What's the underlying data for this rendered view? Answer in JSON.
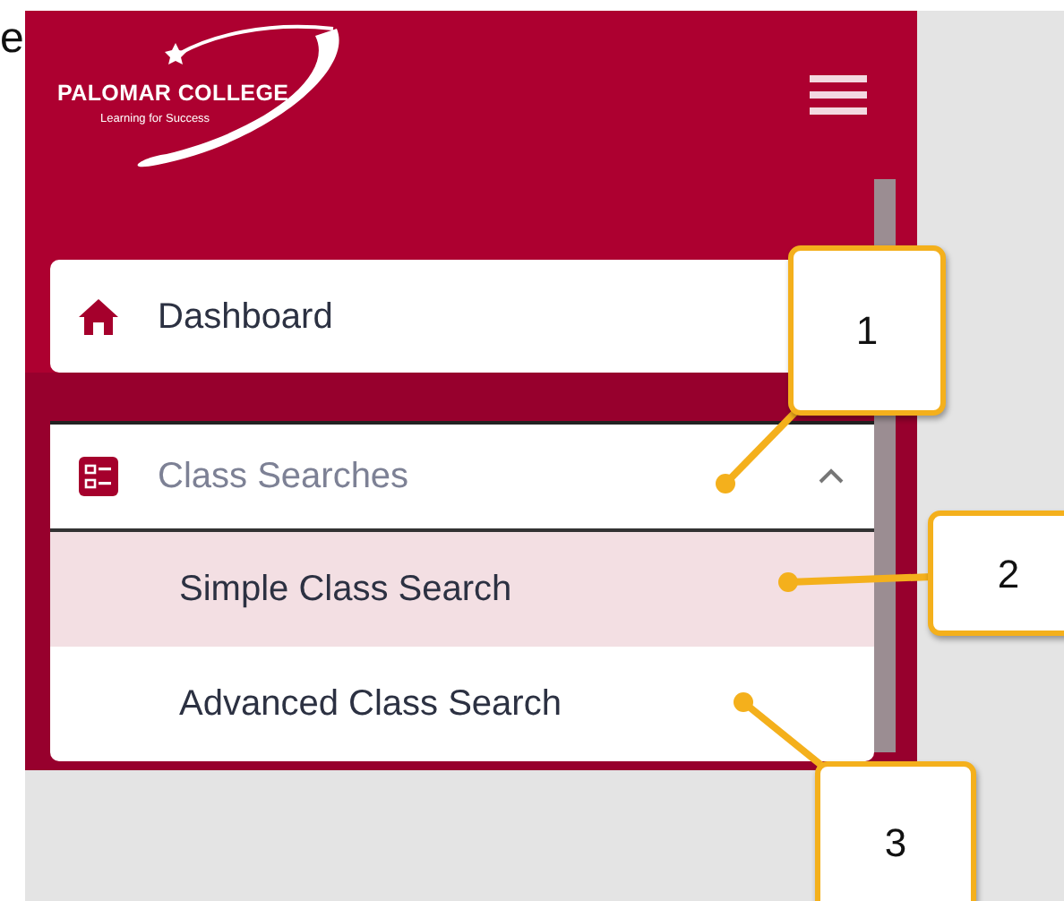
{
  "partial_text": "e",
  "logo": {
    "name": "PALOMAR COLLEGE",
    "tagline": "Learning for Success"
  },
  "menu": [
    {
      "kind": "link",
      "label": "Dashboard"
    },
    {
      "kind": "group",
      "label": "Class Searches",
      "expanded": true,
      "children": [
        {
          "label": "Simple Class Search",
          "selected": true
        },
        {
          "label": "Advanced Class Search",
          "selected": false
        }
      ]
    }
  ],
  "callouts": [
    "1",
    "2",
    "3"
  ]
}
